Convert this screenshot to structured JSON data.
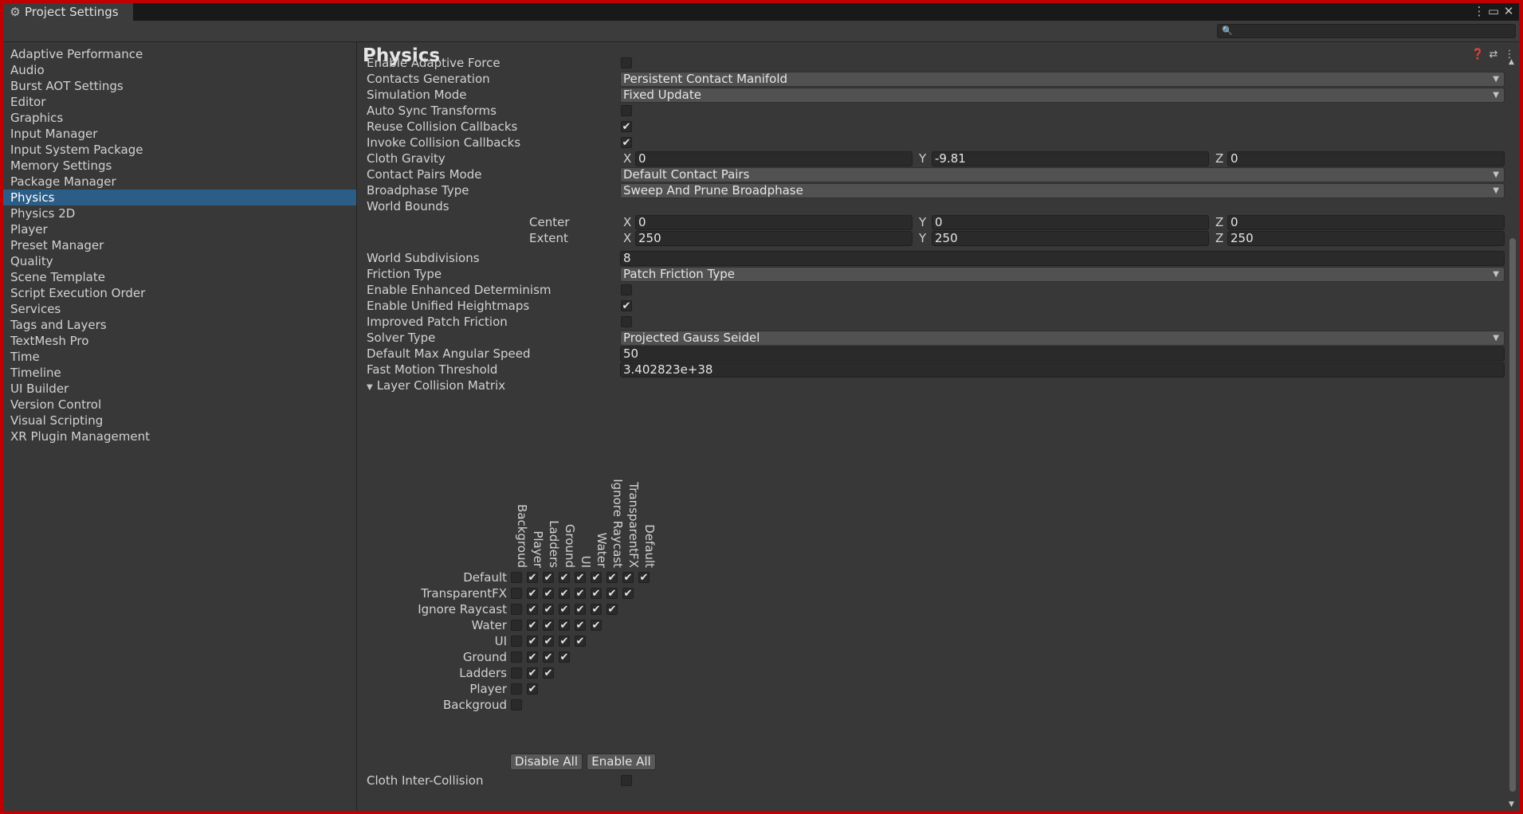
{
  "window": {
    "title": "Project Settings"
  },
  "sidebar": {
    "items": [
      "Adaptive Performance",
      "Audio",
      "Burst AOT Settings",
      "Editor",
      "Graphics",
      "Input Manager",
      "Input System Package",
      "Memory Settings",
      "Package Manager",
      "Physics",
      "Physics 2D",
      "Player",
      "Preset Manager",
      "Quality",
      "Scene Template",
      "Script Execution Order",
      "Services",
      "Tags and Layers",
      "TextMesh Pro",
      "Time",
      "Timeline",
      "UI Builder",
      "Version Control",
      "Visual Scripting",
      "XR Plugin Management"
    ],
    "selected": "Physics"
  },
  "page": {
    "title": "Physics"
  },
  "settings": {
    "enable_adaptive_force": {
      "label": "Enable Adaptive Force",
      "checked": false
    },
    "contacts_generation": {
      "label": "Contacts Generation",
      "value": "Persistent Contact Manifold"
    },
    "simulation_mode": {
      "label": "Simulation Mode",
      "value": "Fixed Update"
    },
    "auto_sync_transforms": {
      "label": "Auto Sync Transforms",
      "checked": false
    },
    "reuse_collision_callbacks": {
      "label": "Reuse Collision Callbacks",
      "checked": true
    },
    "invoke_collision_callbacks": {
      "label": "Invoke Collision Callbacks",
      "checked": true
    },
    "cloth_gravity": {
      "label": "Cloth Gravity",
      "x": "0",
      "y": "-9.81",
      "z": "0"
    },
    "contact_pairs_mode": {
      "label": "Contact Pairs Mode",
      "value": "Default Contact Pairs"
    },
    "broadphase_type": {
      "label": "Broadphase Type",
      "value": "Sweep And Prune Broadphase"
    },
    "world_bounds": {
      "label": "World Bounds",
      "center": {
        "label": "Center",
        "x": "0",
        "y": "0",
        "z": "0"
      },
      "extent": {
        "label": "Extent",
        "x": "250",
        "y": "250",
        "z": "250"
      }
    },
    "world_subdivisions": {
      "label": "World Subdivisions",
      "value": "8"
    },
    "friction_type": {
      "label": "Friction Type",
      "value": "Patch Friction Type"
    },
    "enable_enhanced_determinism": {
      "label": "Enable Enhanced Determinism",
      "checked": false
    },
    "enable_unified_heightmaps": {
      "label": "Enable Unified Heightmaps",
      "checked": true
    },
    "improved_patch_friction": {
      "label": "Improved Patch Friction",
      "checked": false
    },
    "solver_type": {
      "label": "Solver Type",
      "value": "Projected Gauss Seidel"
    },
    "default_max_angular_speed": {
      "label": "Default Max Angular Speed",
      "value": "50"
    },
    "fast_motion_threshold": {
      "label": "Fast Motion Threshold",
      "value": "3.402823e+38"
    },
    "cloth_inter_collision": {
      "label": "Cloth Inter-Collision",
      "checked": false
    }
  },
  "axis": {
    "x": "X",
    "y": "Y",
    "z": "Z"
  },
  "matrix": {
    "label": "Layer Collision Matrix",
    "rows": [
      "Default",
      "TransparentFX",
      "Ignore Raycast",
      "Water",
      "UI",
      "Ground",
      "Ladders",
      "Player",
      "Backgroud"
    ],
    "columns": [
      "Backgroud",
      "Player",
      "Ladders",
      "Ground",
      "UI",
      "Water",
      "Ignore Raycast",
      "TransparentFX",
      "Default"
    ],
    "checks": [
      [
        0,
        1,
        1,
        1,
        1,
        1,
        1,
        1,
        1
      ],
      [
        0,
        1,
        1,
        1,
        1,
        1,
        1,
        1
      ],
      [
        0,
        1,
        1,
        1,
        1,
        1,
        1
      ],
      [
        0,
        1,
        1,
        1,
        1,
        1
      ],
      [
        0,
        1,
        1,
        1,
        1
      ],
      [
        0,
        1,
        1,
        1
      ],
      [
        0,
        1,
        1
      ],
      [
        0,
        1
      ],
      [
        0
      ]
    ],
    "disable_all": "Disable All",
    "enable_all": "Enable All"
  },
  "icons": {
    "window": "gear-icon",
    "header": [
      "help-icon",
      "preset-icon",
      "more-icon"
    ],
    "search": "search-icon"
  }
}
